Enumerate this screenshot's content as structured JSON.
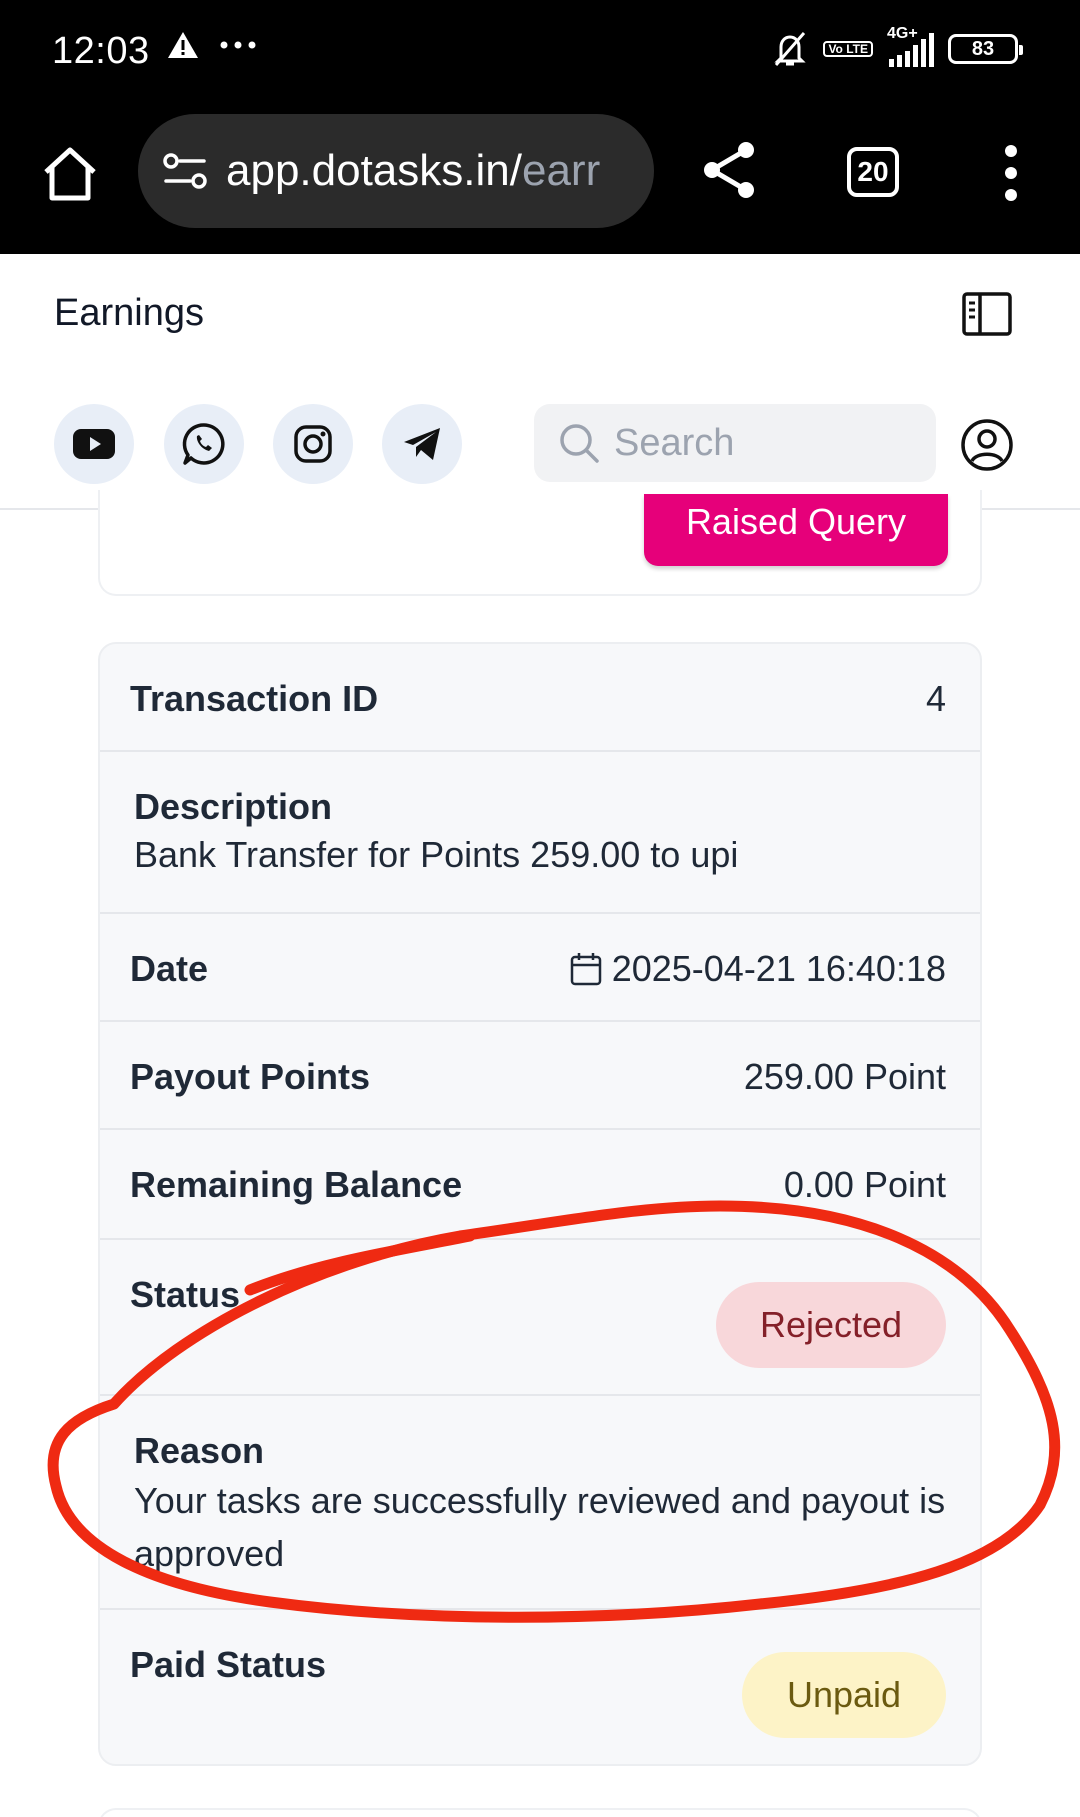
{
  "status_bar": {
    "time": "12:03",
    "network": "4G+",
    "volte": "Vo LTE",
    "battery": "83"
  },
  "browser": {
    "url_host": "app.dotasks.in/",
    "url_path": "earr",
    "tab_count": "20"
  },
  "header": {
    "title": "Earnings",
    "search_placeholder": "Search"
  },
  "social_icons": [
    "youtube-icon",
    "whatsapp-icon",
    "instagram-icon",
    "telegram-icon"
  ],
  "prev_card": {
    "button_label": "Raised Query"
  },
  "transaction": {
    "id_label": "Transaction ID",
    "id_value": "4",
    "description_label": "Description",
    "description_value": "Bank Transfer for Points 259.00 to upi",
    "date_label": "Date",
    "date_value": "2025-04-21 16:40:18",
    "payout_label": "Payout Points",
    "payout_value": "259.00 Point",
    "balance_label": "Remaining Balance",
    "balance_value": "0.00 Point",
    "status_label": "Status",
    "status_value": "Rejected",
    "reason_label": "Reason",
    "reason_value": "Your tasks are successfully reviewed and payout is approved",
    "paid_status_label": "Paid Status",
    "paid_status_value": "Unpaid"
  },
  "colors": {
    "accent_pink": "#e6007a",
    "rejected_bg": "#f8d7da",
    "unpaid_bg": "#fdf3c7",
    "annotation_red": "#ef2a12"
  }
}
